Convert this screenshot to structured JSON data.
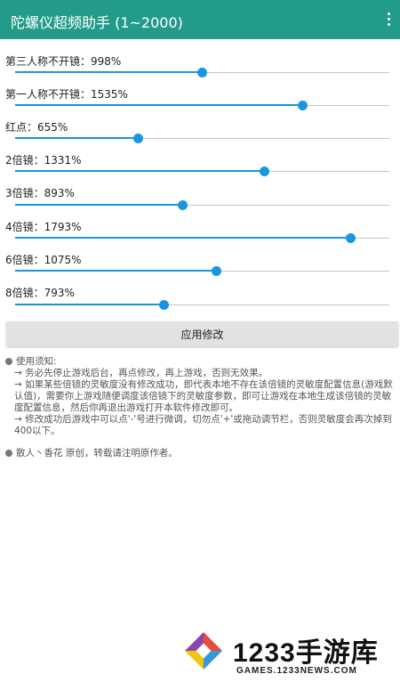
{
  "appbar": {
    "title": "陀螺仪超频助手 (1~2000)",
    "menu_icon": "more-vert-icon"
  },
  "sliders": [
    {
      "label": "第三人称不开镜：998%",
      "value": 998,
      "max": 2000
    },
    {
      "label": "第一人称不开镜：1535%",
      "value": 1535,
      "max": 2000
    },
    {
      "label": "红点：655%",
      "value": 655,
      "max": 2000
    },
    {
      "label": "2倍镜：1331%",
      "value": 1331,
      "max": 2000
    },
    {
      "label": "3倍镜：893%",
      "value": 893,
      "max": 2000
    },
    {
      "label": "4倍镜：1793%",
      "value": 1793,
      "max": 2000
    },
    {
      "label": "6倍镜：1075%",
      "value": 1075,
      "max": 2000
    },
    {
      "label": "8倍镜：793%",
      "value": 793,
      "max": 2000
    }
  ],
  "apply_button": "应用修改",
  "notes": {
    "heading": "使用须知:",
    "line1": "→ 务必先停止游戏后台，再点修改，再上游戏，否则无效果。",
    "line2": "→ 如果某些倍镜的灵敏度没有修改成功，即代表本地不存在该倍镜的灵敏度配置信息(游戏默认值)，需要你上游戏随便调度该倍镜下的灵敏度参数，即可让游戏在本地生成该倍镜的灵敏度配置信息，然后你再退出游戏打开本软件修改即可。",
    "line3": "→ 修改成功后游戏中可以点'-'号进行微调，切勿点'+'或拖动调节栏，否则灵敏度会再次掉到400以下。"
  },
  "credit": "散人丶香花 原创，转载请注明原作者。",
  "watermark": {
    "brand": "1233手游库",
    "url": "GAMES.1233NEWS.COM"
  },
  "colors": {
    "appbar": "#239b8b",
    "accent": "#1a96e0"
  }
}
